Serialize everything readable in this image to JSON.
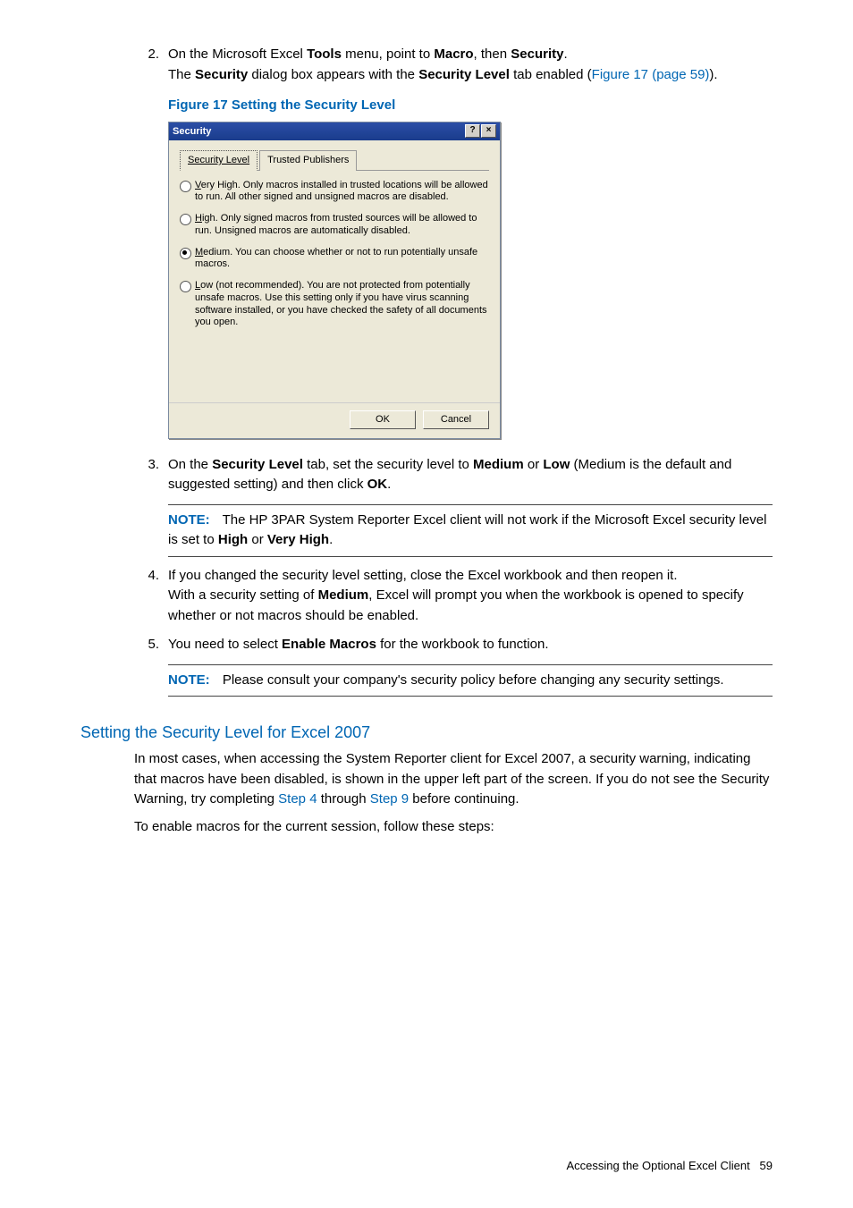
{
  "steps": {
    "s2": {
      "num": "2.",
      "line1a": "On the Microsoft Excel ",
      "line1b": "Tools",
      "line1c": " menu, point to ",
      "line1d": "Macro",
      "line1e": ", then ",
      "line1f": "Security",
      "line1g": ".",
      "line2a": "The ",
      "line2b": "Security",
      "line2c": " dialog box appears with the ",
      "line2d": "Security Level",
      "line2e": " tab enabled (",
      "line2link": "Figure 17 (page 59)",
      "line2f": ")."
    },
    "fig_caption": "Figure 17 Setting the Security Level",
    "s3": {
      "num": "3.",
      "t1": "On the ",
      "b1": "Security Level",
      "t2": " tab, set the security level to ",
      "b2": "Medium",
      "t3": " or ",
      "b3": "Low",
      "t4": " (Medium is the default and suggested setting) and then click ",
      "b4": "OK",
      "t5": "."
    },
    "note1": {
      "label": "NOTE:",
      "t1": "The HP 3PAR System Reporter Excel client will not work if the Microsoft Excel security level is set to ",
      "b1": "High",
      "t2": " or ",
      "b2": "Very High",
      "t3": "."
    },
    "s4": {
      "num": "4.",
      "t1": "If you changed the security level setting, close the Excel workbook and then reopen it.",
      "t2a": "With a security setting of ",
      "t2b": "Medium",
      "t2c": ", Excel will prompt you when the workbook is opened to specify whether or not macros should be enabled."
    },
    "s5": {
      "num": "5.",
      "t1": "You need to select ",
      "b1": "Enable Macros",
      "t2": " for the workbook to function."
    },
    "note2": {
      "label": "NOTE:",
      "t1": "Please consult your company's security policy before changing any security settings."
    }
  },
  "dialog": {
    "title": "Security",
    "help_glyph": "?",
    "close_glyph": "×",
    "tab1": "Security Level",
    "tab2": "Trusted Publishers",
    "opt_vh_u": "V",
    "opt_vh": "ery High. Only macros installed in trusted locations will be allowed to run. All other signed and unsigned macros are disabled.",
    "opt_h_u": "H",
    "opt_h": "igh. Only signed macros from trusted sources will be allowed to run. Unsigned macros are automatically disabled.",
    "opt_m_u": "M",
    "opt_m": "edium. You can choose whether or not to run potentially unsafe macros.",
    "opt_l_u": "L",
    "opt_l": "ow (not recommended). You are not protected from potentially unsafe macros. Use this setting only if you have virus scanning software installed, or you have checked the safety of all documents you open.",
    "ok": "OK",
    "cancel": "Cancel"
  },
  "section2007": {
    "heading": "Setting the Security Level for Excel 2007",
    "p1a": "In most cases, when accessing the System Reporter client for Excel 2007, a security warning, indicating that macros have been disabled, is shown in the upper left part of the screen. If you do not see the Security Warning, try completing ",
    "link1": "Step 4",
    "p1b": " through ",
    "link2": "Step 9",
    "p1c": " before continuing.",
    "p2": "To enable macros for the current session, follow these steps:"
  },
  "footer": {
    "text": "Accessing the Optional Excel Client",
    "page": "59"
  }
}
